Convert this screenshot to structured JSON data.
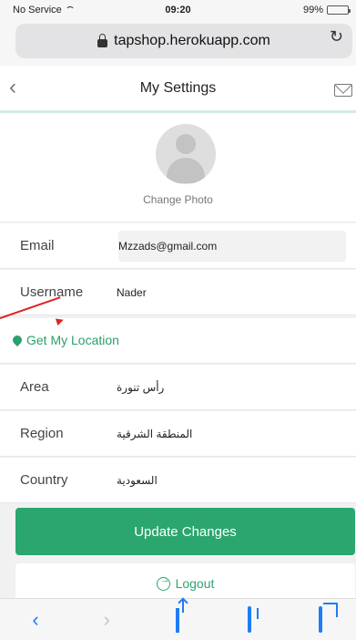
{
  "status_bar": {
    "carrier": "No Service",
    "time": "09:20",
    "battery": "99%",
    "battery_level": 0.99
  },
  "browser": {
    "url": "tapshop.herokuapp.com"
  },
  "header": {
    "title": "My Settings"
  },
  "profile": {
    "change_photo_label": "Change Photo"
  },
  "fields": {
    "email": {
      "label": "Email",
      "value": "Mzzads@gmail.com"
    },
    "username": {
      "label": "Username",
      "value": "Nader"
    },
    "area": {
      "label": "Area",
      "value": "رأس تنورة"
    },
    "region": {
      "label": "Region",
      "value": "المنطقة الشرقية"
    },
    "country": {
      "label": "Country",
      "value": "السعودية"
    }
  },
  "location": {
    "label": "Get My Location"
  },
  "actions": {
    "update_label": "Update Changes",
    "logout_label": "Logout"
  },
  "colors": {
    "accent": "#2aa66e",
    "annotation": "#dd2222",
    "link": "#1f7cf4"
  }
}
